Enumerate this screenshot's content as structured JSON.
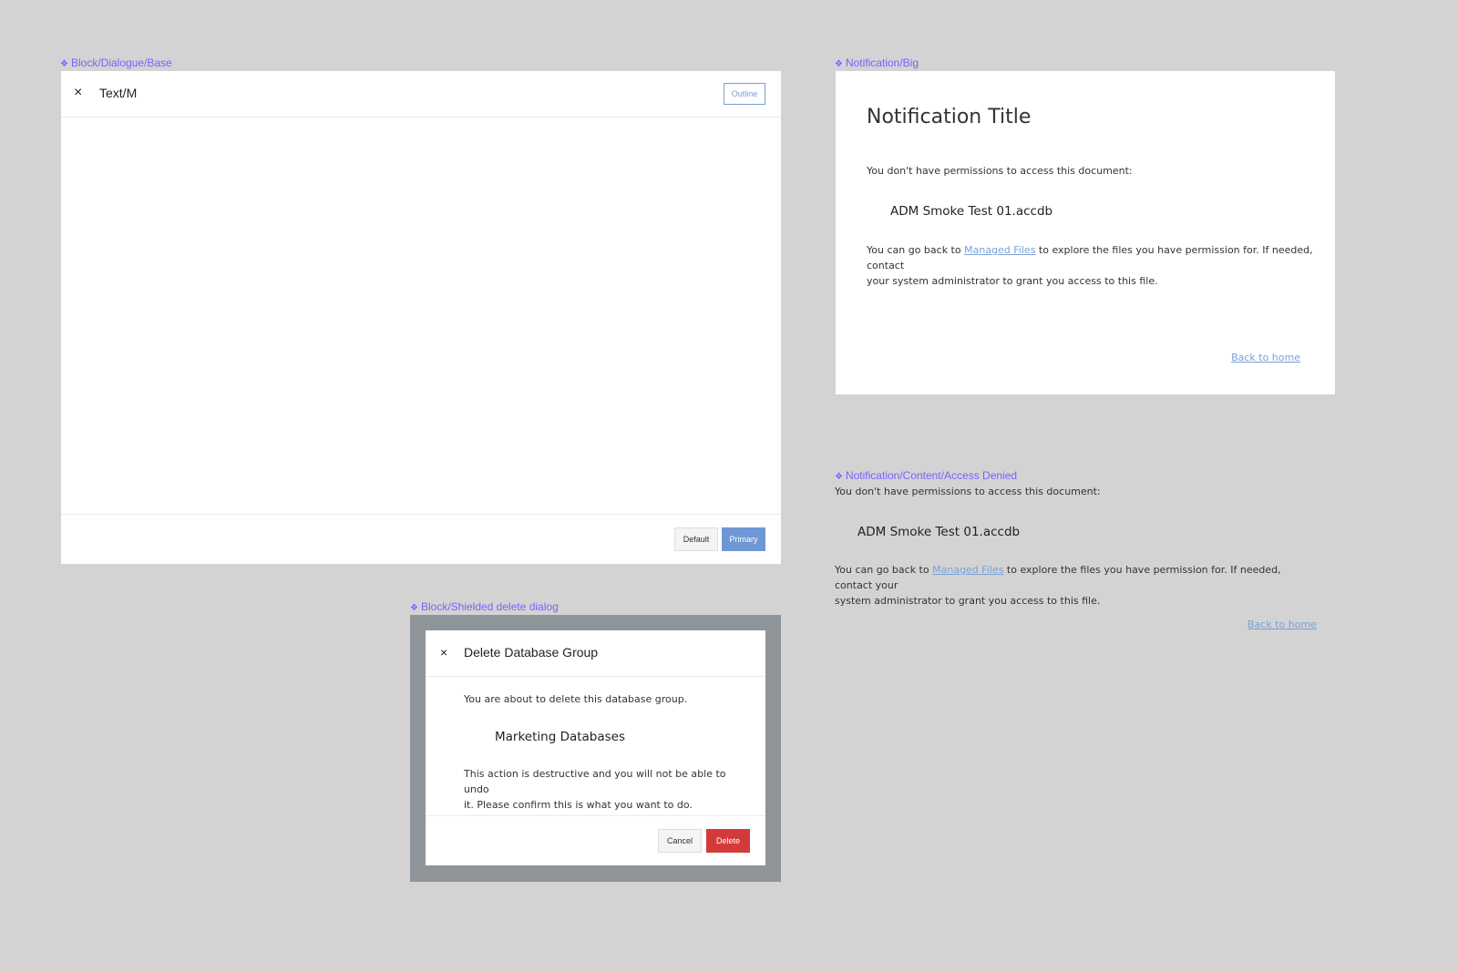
{
  "frames": {
    "dialogue_base": "Block/Dialogue/Base",
    "notification_big": "Notification/Big",
    "access_denied": "Notification/Content/Access Denied",
    "shielded_delete": "Block/Shielded delete dialog"
  },
  "dialogue_base": {
    "close_glyph": "×",
    "title": "Text/M",
    "outline_label": "Outline",
    "default_label": "Default",
    "primary_label": "Primary"
  },
  "notification_big": {
    "title": "Notification Title",
    "intro": "You don't have permissions to access this document:",
    "filename": "ADM Smoke Test 01.accdb",
    "body_pre": "You can go back to ",
    "link_text": "Managed Files",
    "body_post_1": " to explore the files you have permission for. If needed, contact",
    "body_post_2": "your system administrator to grant you access to this file.",
    "back_link": "Back to home"
  },
  "access_denied": {
    "intro": "You don't have permissions to access this document:",
    "filename": "ADM Smoke Test 01.accdb",
    "body_pre": "You can go back to ",
    "link_text": "Managed Files",
    "body_post_1": " to explore the files you have permission for. If needed, contact your",
    "body_post_2": "system administrator to grant you access to this file.",
    "back_link": "Back to home"
  },
  "shielded_delete": {
    "close_glyph": "×",
    "title": "Delete Database Group",
    "intro": "You are about to delete this database group.",
    "group_name": "Marketing Databases",
    "warning_1": "This action is destructive and you will not be able to undo",
    "warning_2": "it. Please confirm this is what you want to do.",
    "cancel_label": "Cancel",
    "delete_label": "Delete"
  },
  "colors": {
    "canvas": "#d3d3d3",
    "frame_label": "#7b61ff",
    "primary": "#6e98d4",
    "danger": "#d33b3b",
    "link": "#7aa0d4",
    "shield_backdrop": "#8f9499"
  },
  "icons": {
    "frame_marker": "component-diamond-icon",
    "close": "close-icon"
  }
}
